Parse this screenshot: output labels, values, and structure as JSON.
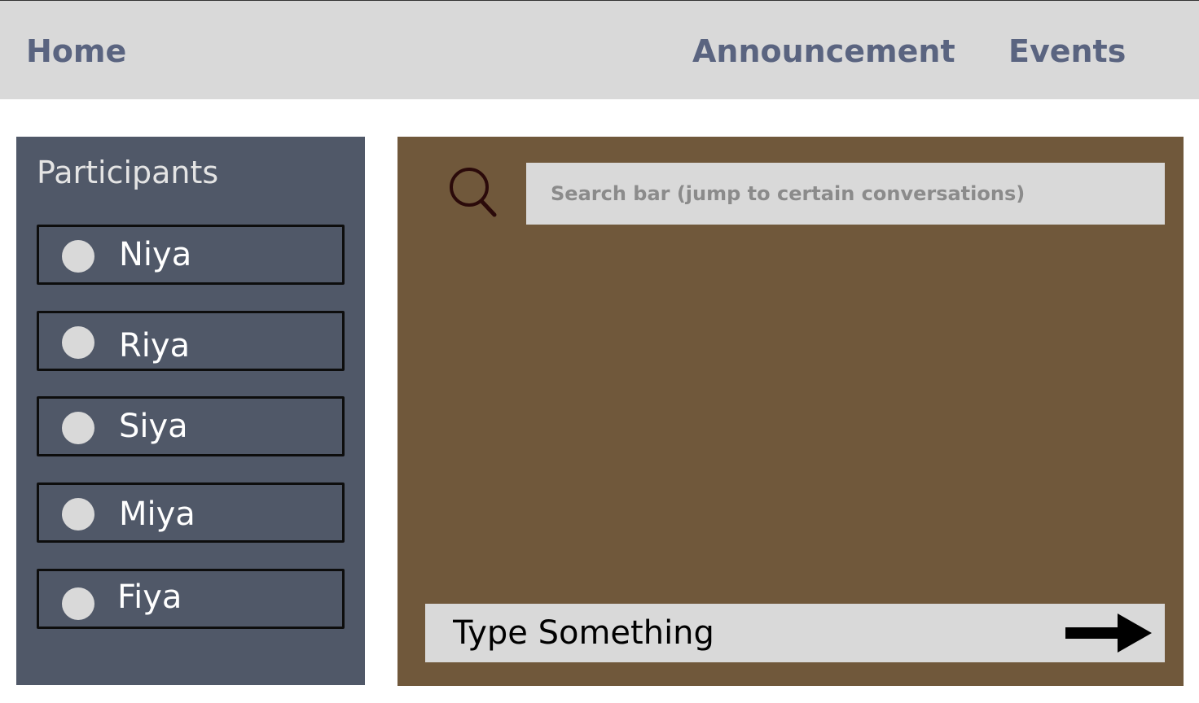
{
  "nav": {
    "home": "Home",
    "announcement": "Announcement",
    "events": "Events"
  },
  "sidebar": {
    "title": "Participants",
    "participants": [
      {
        "name": "Niya"
      },
      {
        "name": "Riya"
      },
      {
        "name": "Siya"
      },
      {
        "name": "Miya"
      },
      {
        "name": "Fiya"
      }
    ]
  },
  "main": {
    "search": {
      "placeholder": "Search bar (jump to certain conversations)",
      "icon": "search-icon"
    },
    "compose": {
      "placeholder": "Type Something",
      "send_icon": "arrow-right-icon"
    }
  },
  "colors": {
    "topbar": "#d9d9d9",
    "nav_text": "#5a6480",
    "sidebar": "#505868",
    "main_panel": "#70583b",
    "input_bg": "#d9d9d9"
  }
}
